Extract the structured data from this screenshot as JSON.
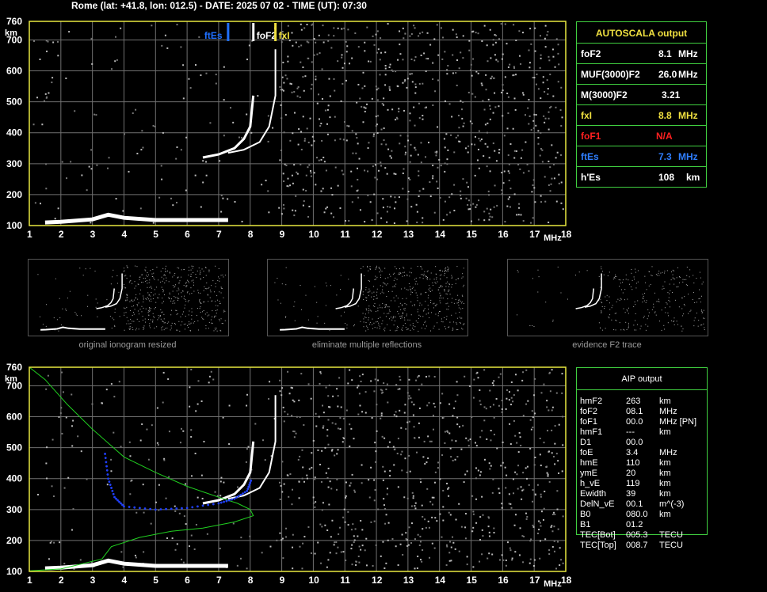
{
  "header": "Rome (lat: +41.8, lon: 012.5) - DATE: 2025 07 02 - TIME (UT): 07:30",
  "colors": {
    "grid": "#707070",
    "frame": "#e8e840",
    "trace": "#ffffff",
    "fte": "#2070ff",
    "fxi": "#f0e040",
    "fof1": "#ff2020",
    "profile": "#20d020",
    "blue_points": "#2040ff"
  },
  "chart_data": [
    {
      "type": "scatter",
      "name": "autoscala-ionogram",
      "xlabel": "MHz",
      "ylabel": "km",
      "x_ticks": [
        "1",
        "2",
        "3",
        "4",
        "5",
        "6",
        "7",
        "8",
        "9",
        "10",
        "11",
        "12",
        "13",
        "14",
        "15",
        "16",
        "17",
        "18"
      ],
      "y_ticks": [
        "100",
        "200",
        "300",
        "400",
        "500",
        "600",
        "700",
        "760"
      ],
      "xlim": [
        1,
        18
      ],
      "ylim": [
        100,
        760
      ],
      "grid": true,
      "markers": [
        {
          "label": "ftEs",
          "x": 7.3,
          "color": "#2070ff"
        },
        {
          "label": "foF2",
          "x": 8.1,
          "color": "#ffffff"
        },
        {
          "label": "fxI",
          "x": 8.8,
          "color": "#f0e040"
        }
      ],
      "es_trace": [
        [
          1.5,
          110
        ],
        [
          2.0,
          112
        ],
        [
          3.0,
          120
        ],
        [
          3.5,
          135
        ],
        [
          4.0,
          125
        ],
        [
          5.0,
          118
        ],
        [
          6.0,
          118
        ],
        [
          7.3,
          118
        ]
      ],
      "f2_o_trace": [
        [
          6.5,
          320
        ],
        [
          7.0,
          330
        ],
        [
          7.5,
          350
        ],
        [
          7.8,
          380
        ],
        [
          8.0,
          420
        ],
        [
          8.1,
          520
        ]
      ],
      "f2_x_trace": [
        [
          7.3,
          335
        ],
        [
          7.8,
          345
        ],
        [
          8.3,
          370
        ],
        [
          8.6,
          420
        ],
        [
          8.8,
          520
        ],
        [
          8.8,
          670
        ]
      ]
    },
    {
      "type": "scatter",
      "name": "aip-ionogram",
      "xlabel": "MHz",
      "ylabel": "km",
      "x_ticks": [
        "1",
        "2",
        "3",
        "4",
        "5",
        "6",
        "7",
        "8",
        "9",
        "10",
        "11",
        "12",
        "13",
        "14",
        "15",
        "16",
        "17",
        "18"
      ],
      "y_ticks": [
        "100",
        "200",
        "300",
        "400",
        "500",
        "600",
        "700",
        "760"
      ],
      "xlim": [
        1,
        18
      ],
      "ylim": [
        100,
        760
      ],
      "grid": true,
      "profile_green": [
        [
          1.0,
          760
        ],
        [
          1.5,
          720
        ],
        [
          2.2,
          640
        ],
        [
          3.0,
          560
        ],
        [
          4.0,
          470
        ],
        [
          5.0,
          420
        ],
        [
          6.0,
          375
        ],
        [
          7.0,
          340
        ],
        [
          7.6,
          320
        ],
        [
          8.0,
          300
        ],
        [
          8.1,
          280
        ],
        [
          7.5,
          260
        ],
        [
          6.5,
          240
        ],
        [
          5.5,
          230
        ],
        [
          4.5,
          210
        ],
        [
          3.6,
          180
        ],
        [
          3.3,
          140
        ],
        [
          2.0,
          108
        ],
        [
          1.0,
          102
        ]
      ],
      "virtual_blue": [
        [
          3.4,
          480
        ],
        [
          3.5,
          400
        ],
        [
          3.7,
          340
        ],
        [
          4.0,
          310
        ],
        [
          5.0,
          300
        ],
        [
          6.0,
          305
        ],
        [
          7.0,
          320
        ],
        [
          7.5,
          335
        ],
        [
          7.9,
          360
        ],
        [
          8.05,
          400
        ]
      ]
    }
  ],
  "thumbs": [
    {
      "caption": "original ionogram resized"
    },
    {
      "caption": "eliminate multiple reflections"
    },
    {
      "caption": "evidence F2 trace"
    }
  ],
  "autoscala": {
    "title": "AUTOSCALA output",
    "rows": [
      {
        "label": "foF2",
        "value": "8.1",
        "unit": "MHz",
        "color": "#ffffff"
      },
      {
        "label": "MUF(3000)F2",
        "value": "26.0",
        "unit": "MHz",
        "color": "#ffffff"
      },
      {
        "label": "M(3000)F2",
        "value": "3.21",
        "unit": "",
        "color": "#ffffff"
      },
      {
        "label": "fxI",
        "value": "8.8",
        "unit": "MHz",
        "color": "#f0e040"
      },
      {
        "label": "foF1",
        "value": "N/A",
        "unit": "",
        "color": "#ff2020"
      },
      {
        "label": "ftEs",
        "value": "7.3",
        "unit": "MHz",
        "color": "#2f7fff"
      },
      {
        "label": "h'Es",
        "value": "108",
        "unit": "km",
        "color": "#ffffff"
      }
    ]
  },
  "aip": {
    "title": "AIP output",
    "rows": [
      {
        "label": "hmF2",
        "value": "263",
        "unit": "km"
      },
      {
        "label": "foF2",
        "value": "08.1",
        "unit": "MHz"
      },
      {
        "label": "foF1",
        "value": "00.0",
        "unit": "MHz   [PN]"
      },
      {
        "label": "hmF1",
        "value": "---",
        "unit": "km"
      },
      {
        "label": "D1",
        "value": "00.0",
        "unit": ""
      },
      {
        "label": "foE",
        "value": "3.4",
        "unit": "MHz"
      },
      {
        "label": "hmE",
        "value": "110",
        "unit": "km"
      },
      {
        "label": "ymE",
        "value": "20",
        "unit": "km"
      },
      {
        "label": "h_vE",
        "value": "119",
        "unit": "km"
      },
      {
        "label": "Ewidth",
        "value": "39",
        "unit": "km"
      },
      {
        "label": "DelN_vE",
        "value": "00.1",
        "unit": "m^(-3)"
      },
      {
        "label": "B0",
        "value": "080.0",
        "unit": "km"
      },
      {
        "label": "B1",
        "value": "01.2",
        "unit": ""
      },
      {
        "label": "TEC[Bot]",
        "value": "005.3",
        "unit": "TECU"
      },
      {
        "label": "TEC[Top]",
        "value": "008.7",
        "unit": "TECU"
      }
    ]
  }
}
